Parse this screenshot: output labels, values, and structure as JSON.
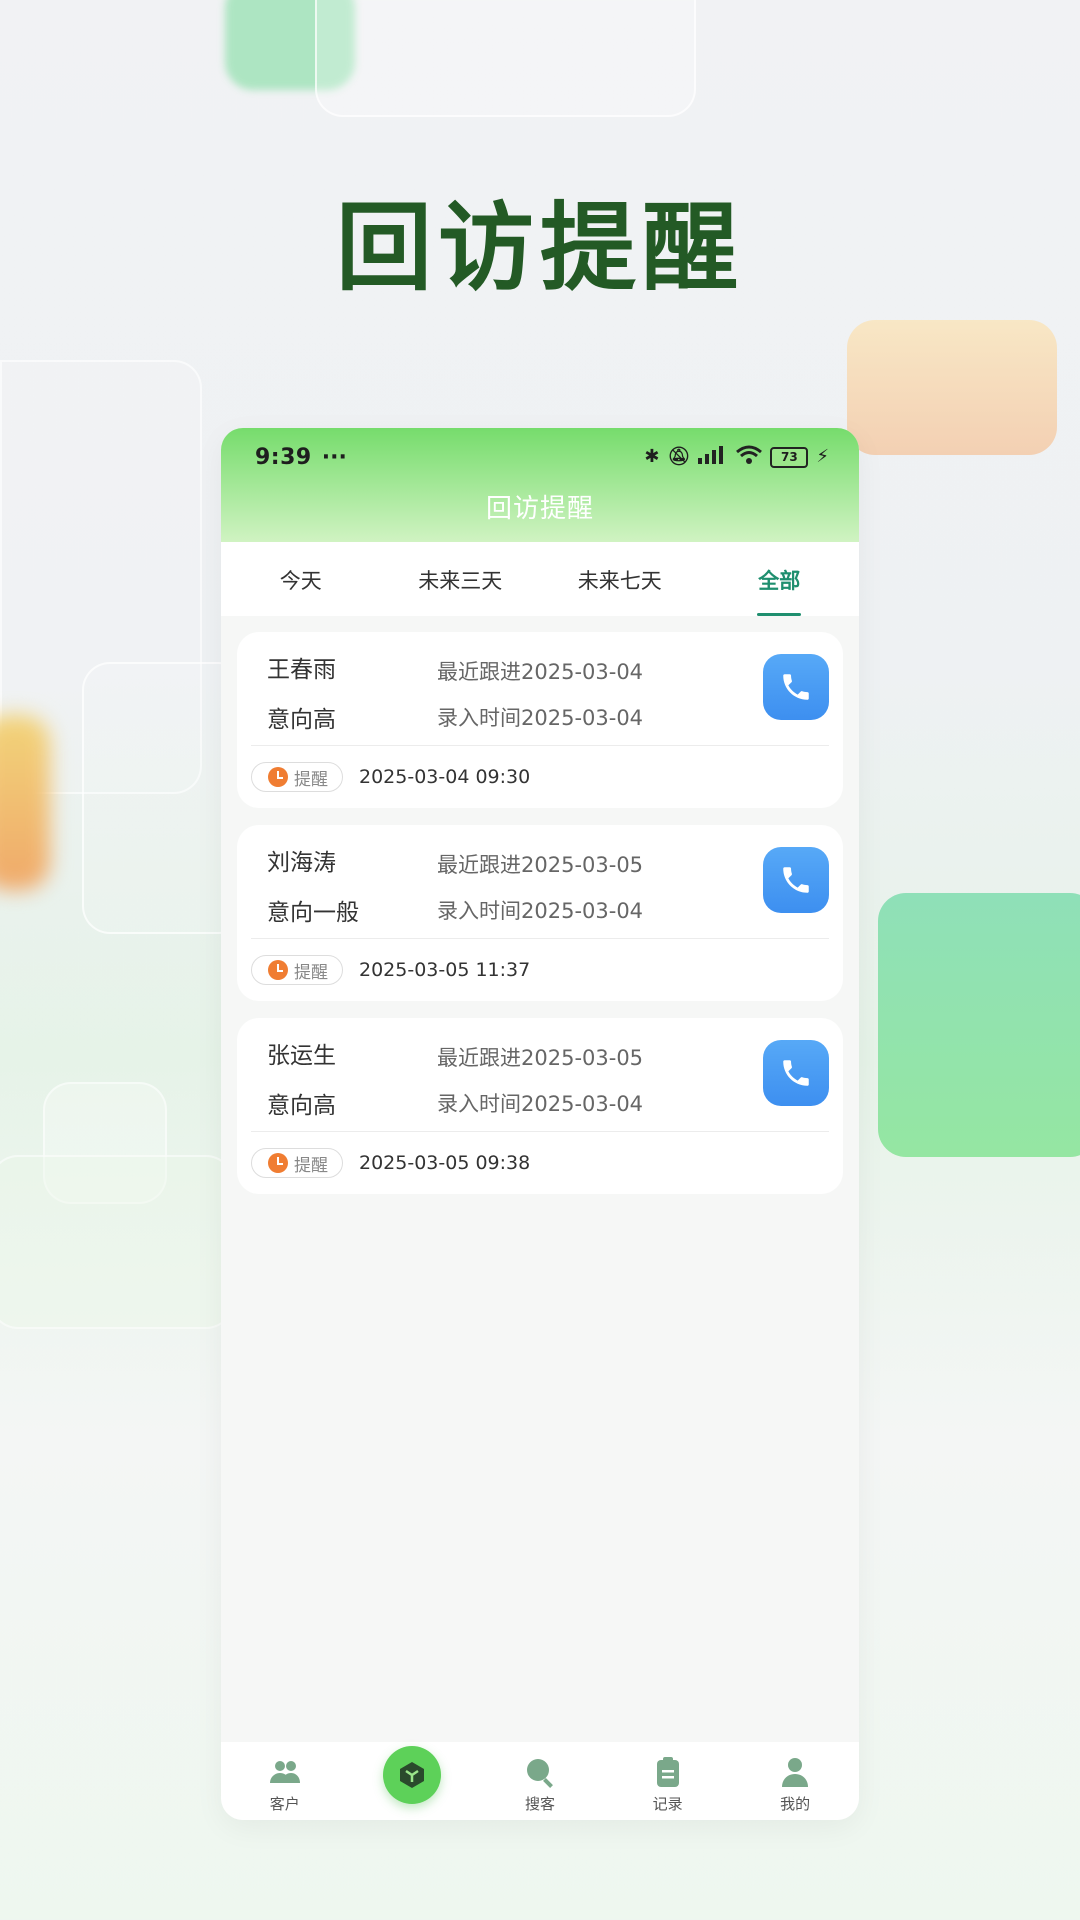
{
  "headline": "回访提醒",
  "status": {
    "time": "9:39",
    "dots": "···",
    "battery": "73"
  },
  "nav": {
    "title": "回访提醒"
  },
  "tabs": [
    {
      "label": "今天",
      "active": false
    },
    {
      "label": "未来三天",
      "active": false
    },
    {
      "label": "未来七天",
      "active": false
    },
    {
      "label": "全部",
      "active": true
    }
  ],
  "cards": [
    {
      "name": "王春雨",
      "intent": "意向高",
      "last_follow_label": "最近跟进",
      "last_follow": "2025-03-04",
      "entry_label": "录入时间",
      "entry": "2025-03-04",
      "remind_label": "提醒",
      "remind_time": "2025-03-04 09:30"
    },
    {
      "name": "刘海涛",
      "intent": "意向一般",
      "last_follow_label": "最近跟进",
      "last_follow": "2025-03-05",
      "entry_label": "录入时间",
      "entry": "2025-03-04",
      "remind_label": "提醒",
      "remind_time": "2025-03-05 11:37"
    },
    {
      "name": "张运生",
      "intent": "意向高",
      "last_follow_label": "最近跟进",
      "last_follow": "2025-03-05",
      "entry_label": "录入时间",
      "entry": "2025-03-04",
      "remind_label": "提醒",
      "remind_time": "2025-03-05 09:38"
    }
  ],
  "bottom_nav": [
    {
      "label": "客户",
      "icon": "users-icon"
    },
    {
      "label": "",
      "icon": "center-cube-icon"
    },
    {
      "label": "搜客",
      "icon": "search-icon"
    },
    {
      "label": "记录",
      "icon": "clipboard-icon"
    },
    {
      "label": "我的",
      "icon": "person-icon"
    }
  ],
  "colors": {
    "accent": "#1f8f6f",
    "headline": "#235a25",
    "call": "#4a9cf4",
    "alarm": "#f07d32",
    "brand_green": "#5dd159"
  }
}
